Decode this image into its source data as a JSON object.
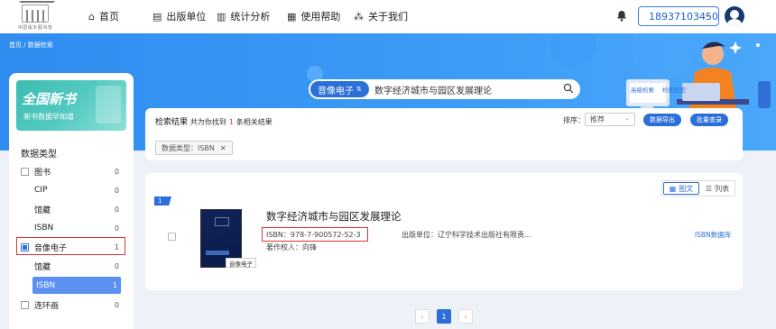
{
  "header": {
    "logo_caption": "中国版本图书馆",
    "nav": [
      {
        "icon": "home-icon",
        "label": "首页"
      },
      {
        "icon": "book-icon",
        "label": "出版单位"
      },
      {
        "icon": "chart-icon",
        "label": "统计分析"
      },
      {
        "icon": "document-icon",
        "label": "使用帮助"
      },
      {
        "icon": "share-icon",
        "label": "关于我们"
      }
    ],
    "phone": "18937103450"
  },
  "breadcrumb": "首页 / 数据检索",
  "search": {
    "category": "音像电子",
    "value": "数字经济城市与园区发展理论",
    "advanced_label": "高级检索",
    "history_label": "检索历史"
  },
  "sidebar": {
    "banner_title": "全国新书",
    "banner_subtitle": "新书数据早知道",
    "section_title": "数据类型",
    "items": [
      {
        "label": "图书",
        "count": "0",
        "level": 0,
        "checked": false
      },
      {
        "label": "CIP",
        "count": "0",
        "level": 1
      },
      {
        "label": "馆藏",
        "count": "0",
        "level": 1
      },
      {
        "label": "ISBN",
        "count": "0",
        "level": 1
      },
      {
        "label": "音像电子",
        "count": "1",
        "level": 0,
        "checked": true
      },
      {
        "label": "馆藏",
        "count": "0",
        "level": 1
      },
      {
        "label": "ISBN",
        "count": "1",
        "level": 1,
        "active": true
      },
      {
        "label": "连环画",
        "count": "0",
        "level": 0,
        "checked": false
      }
    ]
  },
  "results": {
    "label": "检索结果",
    "summary_pre": "共为你找到",
    "summary_count": "1",
    "summary_post": "条相关结果",
    "sort_label": "排序：",
    "sort_value": "推荐",
    "export_label": "数据导出",
    "bulk_label": "批量查录",
    "filter_tag": "数据类型：ISBN"
  },
  "record": {
    "index": "1",
    "cover_label": "音像电子",
    "title": "数字经济城市与园区发展理论",
    "isbn": "ISBN：978-7-900572-52-3",
    "owner": "著作权人：向锋",
    "publisher": "出版单位：辽宁科学技术出版社有限责...",
    "db_link": "ISBN数据库",
    "view_grid": "图文",
    "view_list": "列表"
  },
  "pagination": {
    "prev": "‹",
    "current": "1",
    "next": "›"
  },
  "colors": {
    "primary": "#2c6fd8",
    "hero": "#3a9af5",
    "highlight": "#e03333"
  }
}
